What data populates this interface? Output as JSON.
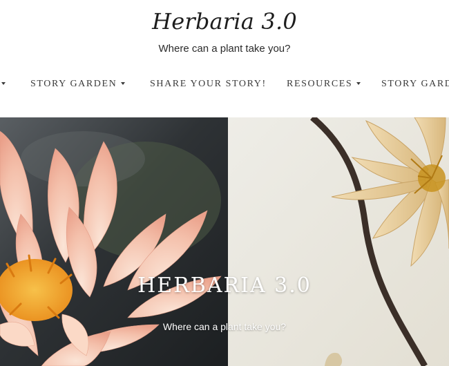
{
  "site": {
    "title": "Herbaria 3.0",
    "tagline": "Where can a plant take you?"
  },
  "nav": {
    "items": [
      {
        "label": "",
        "has_dropdown": true
      },
      {
        "label": "STORY GARDEN",
        "has_dropdown": true
      },
      {
        "label": "SHARE YOUR STORY!",
        "has_dropdown": false
      },
      {
        "label": "RESOURCES",
        "has_dropdown": true
      },
      {
        "label": "STORY GARD",
        "has_dropdown": false
      }
    ]
  },
  "hero": {
    "title": "HERBARIA 3.0",
    "subtitle": "Where can a plant take you?"
  },
  "colors": {
    "text_dark": "#1d1d1d",
    "nav_text": "#3a3a3a",
    "hero_text": "#ffffff",
    "lotus_petal": "#f4c6b4",
    "lotus_center": "#f0a228",
    "pressed_flower": "#e7cf9f",
    "paper_background": "#ebe8df"
  },
  "icons": {
    "dropdown": "caret-down-icon"
  }
}
